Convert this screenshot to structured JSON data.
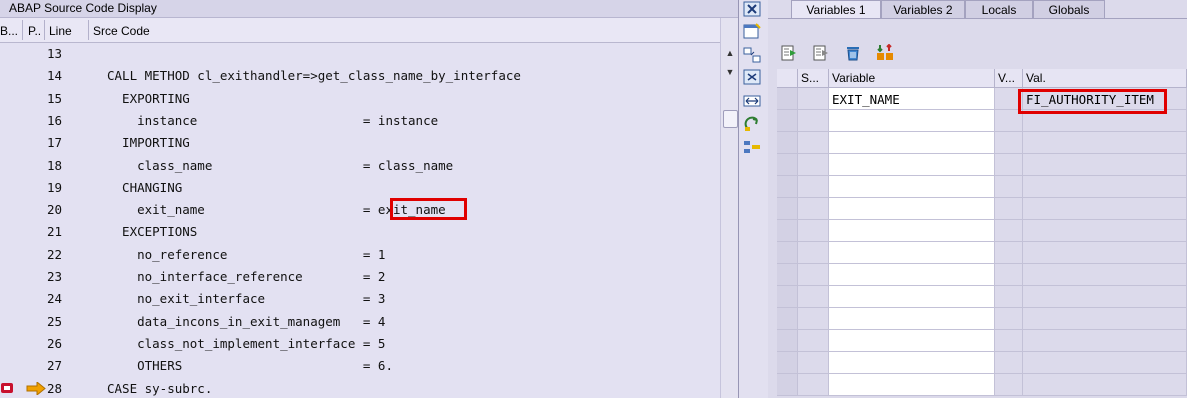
{
  "source_panel": {
    "title": "ABAP Source Code Display",
    "columns": {
      "breakpoint": "B...",
      "p": "P..",
      "line": "Line",
      "source": "Srce Code"
    },
    "rows": [
      {
        "line": "13",
        "code": ""
      },
      {
        "line": "14",
        "code": "CALL METHOD cl_exithandler=>get_class_name_by_interface"
      },
      {
        "line": "15",
        "code": "  EXPORTING"
      },
      {
        "line": "16",
        "code": "    instance                      = instance"
      },
      {
        "line": "17",
        "code": "  IMPORTING"
      },
      {
        "line": "18",
        "code": "    class_name                    = class_name"
      },
      {
        "line": "19",
        "code": "  CHANGING"
      },
      {
        "line": "20",
        "code": "    exit_name                     = exit_name"
      },
      {
        "line": "21",
        "code": "  EXCEPTIONS"
      },
      {
        "line": "22",
        "code": "    no_reference                  = 1"
      },
      {
        "line": "23",
        "code": "    no_interface_reference        = 2"
      },
      {
        "line": "24",
        "code": "    no_exit_interface             = 3"
      },
      {
        "line": "25",
        "code": "    data_incons_in_exit_managem   = 4"
      },
      {
        "line": "26",
        "code": "    class_not_implement_interface = 5"
      },
      {
        "line": "27",
        "code": "    OTHERS                        = 6."
      },
      {
        "line": "28",
        "code": "CASE sy-subrc."
      }
    ],
    "current_line": "28"
  },
  "vertical_toolbar": {
    "icons": [
      "close-icon",
      "new-session-icon",
      "full-screen-icon",
      "maximize-icon",
      "expand-width-icon",
      "swap-icon",
      "layout-icon"
    ]
  },
  "variables_panel": {
    "tabs": [
      {
        "label": "Variables 1",
        "active": true
      },
      {
        "label": "Variables 2",
        "active": false
      },
      {
        "label": "Locals",
        "active": false
      },
      {
        "label": "Globals",
        "active": false
      }
    ],
    "toolbar_icons": [
      "insert-row-icon",
      "copy-row-icon",
      "delete-icon",
      "sort-icon"
    ],
    "columns": {
      "s": "S...",
      "variable": "Variable",
      "v": "V...",
      "value": "Val."
    },
    "rows": [
      {
        "variable": "EXIT_NAME",
        "value": "FI_AUTHORITY_ITEM"
      },
      {
        "variable": "",
        "value": ""
      },
      {
        "variable": "",
        "value": ""
      },
      {
        "variable": "",
        "value": ""
      },
      {
        "variable": "",
        "value": ""
      },
      {
        "variable": "",
        "value": ""
      },
      {
        "variable": "",
        "value": ""
      },
      {
        "variable": "",
        "value": ""
      },
      {
        "variable": "",
        "value": ""
      },
      {
        "variable": "",
        "value": ""
      },
      {
        "variable": "",
        "value": ""
      },
      {
        "variable": "",
        "value": ""
      },
      {
        "variable": "",
        "value": ""
      },
      {
        "variable": "",
        "value": ""
      }
    ]
  },
  "colors": {
    "highlight": "#e00000",
    "panel_bg": "#e3e1f2",
    "current_arrow": "#f0a000"
  }
}
